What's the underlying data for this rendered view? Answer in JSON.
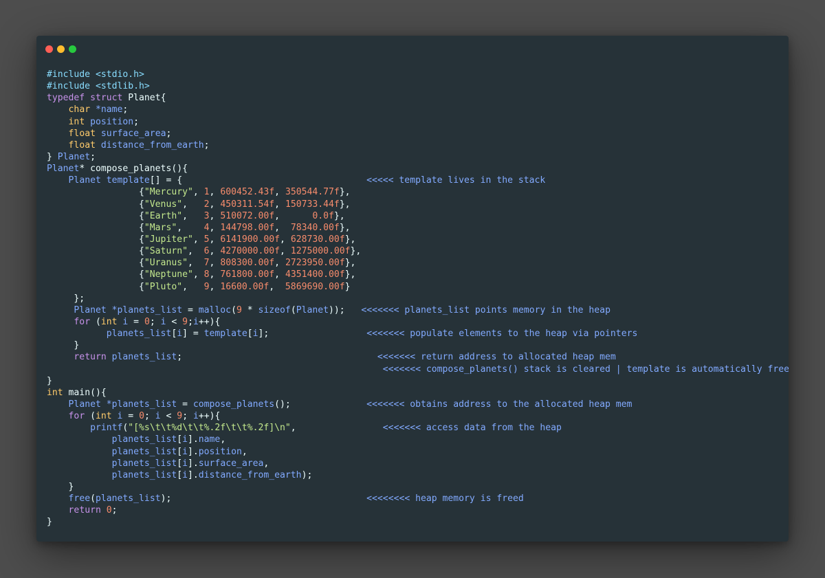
{
  "colors": {
    "background": "#4d4d4d",
    "editor": "#263238",
    "plain": "#eeffff",
    "keyword": "#c792ea",
    "type": "#ffcb6b",
    "identifier": "#82aaff",
    "number": "#f78c6c",
    "string": "#c3e88d",
    "punct": "#89ddff",
    "preproc": "#89ddff",
    "comment": "#82aaff",
    "close": "#ff5f56",
    "minimize": "#ffbd2e",
    "maximize": "#27c93f"
  },
  "window_controls": [
    {
      "name": "close-button",
      "color": "#ff5f56"
    },
    {
      "name": "minimize-button",
      "color": "#ffbd2e"
    },
    {
      "name": "maximize-button",
      "color": "#27c93f"
    }
  ],
  "lines": [
    [
      [
        "pp",
        "#include <stdio.h>"
      ]
    ],
    [
      [
        "pp",
        "#include <stdlib.h>"
      ]
    ],
    [
      [
        "kw",
        "typedef"
      ],
      [
        "pl",
        " "
      ],
      [
        "kw",
        "struct"
      ],
      [
        "pl",
        " Planet{"
      ]
    ],
    [
      [
        "pl",
        "    "
      ],
      [
        "ty",
        "char"
      ],
      [
        "pl",
        " "
      ],
      [
        "id",
        "*name"
      ],
      [
        "pl",
        ";"
      ]
    ],
    [
      [
        "pl",
        "    "
      ],
      [
        "ty",
        "int"
      ],
      [
        "pl",
        " "
      ],
      [
        "id",
        "position"
      ],
      [
        "pl",
        ";"
      ]
    ],
    [
      [
        "pl",
        "    "
      ],
      [
        "ty",
        "float"
      ],
      [
        "pl",
        " "
      ],
      [
        "id",
        "surface_area"
      ],
      [
        "pl",
        ";"
      ]
    ],
    [
      [
        "pl",
        "    "
      ],
      [
        "ty",
        "float"
      ],
      [
        "pl",
        " "
      ],
      [
        "id",
        "distance_from_earth"
      ],
      [
        "pl",
        ";"
      ]
    ],
    [
      [
        "pl",
        "} "
      ],
      [
        "id",
        "Planet"
      ],
      [
        "pl",
        ";"
      ]
    ],
    [
      [
        "id",
        "Planet"
      ],
      [
        "pl",
        "* compose_planets(){"
      ]
    ],
    [
      [
        "pl",
        "    "
      ],
      [
        "id",
        "Planet template"
      ],
      [
        "pl",
        "[] = {                                  "
      ],
      [
        "cm",
        "<<<<< template lives in the stack"
      ]
    ],
    [
      [
        "pl",
        "                 {"
      ],
      [
        "st",
        "\"Mercury\""
      ],
      [
        "pl",
        ", "
      ],
      [
        "nu",
        "1"
      ],
      [
        "pl",
        ", "
      ],
      [
        "nu",
        "600452.43f"
      ],
      [
        "pl",
        ", "
      ],
      [
        "nu",
        "350544.77f"
      ],
      [
        "pl",
        "},"
      ]
    ],
    [
      [
        "pl",
        "                 {"
      ],
      [
        "st",
        "\"Venus\""
      ],
      [
        "pl",
        ",   "
      ],
      [
        "nu",
        "2"
      ],
      [
        "pl",
        ", "
      ],
      [
        "nu",
        "450311.54f"
      ],
      [
        "pl",
        ", "
      ],
      [
        "nu",
        "150733.44f"
      ],
      [
        "pl",
        "},"
      ]
    ],
    [
      [
        "pl",
        "                 {"
      ],
      [
        "st",
        "\"Earth\""
      ],
      [
        "pl",
        ",   "
      ],
      [
        "nu",
        "3"
      ],
      [
        "pl",
        ", "
      ],
      [
        "nu",
        "510072.00f"
      ],
      [
        "pl",
        ",      "
      ],
      [
        "nu",
        "0.0f"
      ],
      [
        "pl",
        "},"
      ]
    ],
    [
      [
        "pl",
        "                 {"
      ],
      [
        "st",
        "\"Mars\""
      ],
      [
        "pl",
        ",    "
      ],
      [
        "nu",
        "4"
      ],
      [
        "pl",
        ", "
      ],
      [
        "nu",
        "144798.00f"
      ],
      [
        "pl",
        ",  "
      ],
      [
        "nu",
        "78340.00f"
      ],
      [
        "pl",
        "},"
      ]
    ],
    [
      [
        "pl",
        "                 {"
      ],
      [
        "st",
        "\"Jupiter\""
      ],
      [
        "pl",
        ", "
      ],
      [
        "nu",
        "5"
      ],
      [
        "pl",
        ", "
      ],
      [
        "nu",
        "6141900.00f"
      ],
      [
        "pl",
        ", "
      ],
      [
        "nu",
        "628730.00f"
      ],
      [
        "pl",
        "},"
      ]
    ],
    [
      [
        "pl",
        "                 {"
      ],
      [
        "st",
        "\"Saturn\""
      ],
      [
        "pl",
        ",  "
      ],
      [
        "nu",
        "6"
      ],
      [
        "pl",
        ", "
      ],
      [
        "nu",
        "4270000.00f"
      ],
      [
        "pl",
        ", "
      ],
      [
        "nu",
        "1275000.00f"
      ],
      [
        "pl",
        "},"
      ]
    ],
    [
      [
        "pl",
        "                 {"
      ],
      [
        "st",
        "\"Uranus\""
      ],
      [
        "pl",
        ",  "
      ],
      [
        "nu",
        "7"
      ],
      [
        "pl",
        ", "
      ],
      [
        "nu",
        "808300.00f"
      ],
      [
        "pl",
        ", "
      ],
      [
        "nu",
        "2723950.00f"
      ],
      [
        "pl",
        "},"
      ]
    ],
    [
      [
        "pl",
        "                 {"
      ],
      [
        "st",
        "\"Neptune\""
      ],
      [
        "pl",
        ", "
      ],
      [
        "nu",
        "8"
      ],
      [
        "pl",
        ", "
      ],
      [
        "nu",
        "761800.00f"
      ],
      [
        "pl",
        ", "
      ],
      [
        "nu",
        "4351400.00f"
      ],
      [
        "pl",
        "},"
      ]
    ],
    [
      [
        "pl",
        "                 {"
      ],
      [
        "st",
        "\"Pluto\""
      ],
      [
        "pl",
        ",   "
      ],
      [
        "nu",
        "9"
      ],
      [
        "pl",
        ", "
      ],
      [
        "nu",
        "16600.00f"
      ],
      [
        "pl",
        ",  "
      ],
      [
        "nu",
        "5869690.00f"
      ],
      [
        "pl",
        "}"
      ]
    ],
    [
      [
        "pl",
        "     };"
      ]
    ],
    [
      [
        "pl",
        "     "
      ],
      [
        "id",
        "Planet *planets_list"
      ],
      [
        "pl",
        " = "
      ],
      [
        "id",
        "malloc"
      ],
      [
        "pl",
        "("
      ],
      [
        "nu",
        "9"
      ],
      [
        "pl",
        " * "
      ],
      [
        "id",
        "sizeof"
      ],
      [
        "pl",
        "("
      ],
      [
        "id",
        "Planet"
      ],
      [
        "pl",
        "));   "
      ],
      [
        "cm",
        "<<<<<<< planets_list points memory in the heap"
      ]
    ],
    [
      [
        "pl",
        "     "
      ],
      [
        "kw",
        "for"
      ],
      [
        "pl",
        " ("
      ],
      [
        "ty",
        "int"
      ],
      [
        "pl",
        " "
      ],
      [
        "id",
        "i"
      ],
      [
        "pl",
        " = "
      ],
      [
        "nu",
        "0"
      ],
      [
        "pl",
        "; "
      ],
      [
        "id",
        "i"
      ],
      [
        "pl",
        " < "
      ],
      [
        "nu",
        "9"
      ],
      [
        "pl",
        ";"
      ],
      [
        "id",
        "i"
      ],
      [
        "pl",
        "++){"
      ]
    ],
    [
      [
        "pl",
        "           "
      ],
      [
        "id",
        "planets_list"
      ],
      [
        "pl",
        "["
      ],
      [
        "id",
        "i"
      ],
      [
        "pl",
        "] = "
      ],
      [
        "id",
        "template"
      ],
      [
        "pl",
        "["
      ],
      [
        "id",
        "i"
      ],
      [
        "pl",
        "];                  "
      ],
      [
        "cm",
        "<<<<<<< populate elements to the heap via pointers"
      ]
    ],
    [
      [
        "pl",
        "     }"
      ]
    ],
    [
      [
        "pl",
        "     "
      ],
      [
        "kw",
        "return"
      ],
      [
        "pl",
        " "
      ],
      [
        "id",
        "planets_list"
      ],
      [
        "pl",
        ";                                    "
      ],
      [
        "cm",
        "<<<<<<< return address to allocated heap mem"
      ]
    ],
    [
      [
        "pl",
        "                                                              "
      ],
      [
        "cm",
        "<<<<<<< compose_planets() stack is cleared | template is automatically free"
      ]
    ],
    [
      [
        "pl",
        "}"
      ]
    ],
    [
      [
        "ty",
        "int"
      ],
      [
        "pl",
        " main(){"
      ]
    ],
    [
      [
        "pl",
        "    "
      ],
      [
        "id",
        "Planet *planets_list"
      ],
      [
        "pl",
        " = "
      ],
      [
        "id",
        "compose_planets"
      ],
      [
        "pl",
        "();              "
      ],
      [
        "cm",
        "<<<<<<< obtains address to the allocated heap mem"
      ]
    ],
    [
      [
        "pl",
        "    "
      ],
      [
        "kw",
        "for"
      ],
      [
        "pl",
        " ("
      ],
      [
        "ty",
        "int"
      ],
      [
        "pl",
        " "
      ],
      [
        "id",
        "i"
      ],
      [
        "pl",
        " = "
      ],
      [
        "nu",
        "0"
      ],
      [
        "pl",
        "; "
      ],
      [
        "id",
        "i"
      ],
      [
        "pl",
        " < "
      ],
      [
        "nu",
        "9"
      ],
      [
        "pl",
        "; "
      ],
      [
        "id",
        "i"
      ],
      [
        "pl",
        "++){"
      ]
    ],
    [
      [
        "pl",
        "        "
      ],
      [
        "id",
        "printf"
      ],
      [
        "pl",
        "("
      ],
      [
        "st",
        "\"[%s\\t\\t%d\\t\\t%.2f\\t\\t%.2f]\\n\""
      ],
      [
        "pl",
        ",                "
      ],
      [
        "cm",
        "<<<<<<< access data from the heap"
      ]
    ],
    [
      [
        "pl",
        "            "
      ],
      [
        "id",
        "planets_list"
      ],
      [
        "pl",
        "["
      ],
      [
        "id",
        "i"
      ],
      [
        "pl",
        "]."
      ],
      [
        "id",
        "name"
      ],
      [
        "pl",
        ","
      ]
    ],
    [
      [
        "pl",
        "            "
      ],
      [
        "id",
        "planets_list"
      ],
      [
        "pl",
        "["
      ],
      [
        "id",
        "i"
      ],
      [
        "pl",
        "]."
      ],
      [
        "id",
        "position"
      ],
      [
        "pl",
        ","
      ]
    ],
    [
      [
        "pl",
        "            "
      ],
      [
        "id",
        "planets_list"
      ],
      [
        "pl",
        "["
      ],
      [
        "id",
        "i"
      ],
      [
        "pl",
        "]."
      ],
      [
        "id",
        "surface_area"
      ],
      [
        "pl",
        ","
      ]
    ],
    [
      [
        "pl",
        "            "
      ],
      [
        "id",
        "planets_list"
      ],
      [
        "pl",
        "["
      ],
      [
        "id",
        "i"
      ],
      [
        "pl",
        "]."
      ],
      [
        "id",
        "distance_from_earth"
      ],
      [
        "pl",
        ");"
      ]
    ],
    [
      [
        "pl",
        "    }"
      ]
    ],
    [
      [
        "pl",
        "    "
      ],
      [
        "id",
        "free"
      ],
      [
        "pl",
        "("
      ],
      [
        "id",
        "planets_list"
      ],
      [
        "pl",
        ");                                    "
      ],
      [
        "cm",
        "<<<<<<<< heap memory is freed"
      ]
    ],
    [
      [
        "pl",
        "    "
      ],
      [
        "kw",
        "return"
      ],
      [
        "pl",
        " "
      ],
      [
        "nu",
        "0"
      ],
      [
        "pl",
        ";"
      ]
    ],
    [
      [
        "pl",
        "}"
      ]
    ]
  ]
}
